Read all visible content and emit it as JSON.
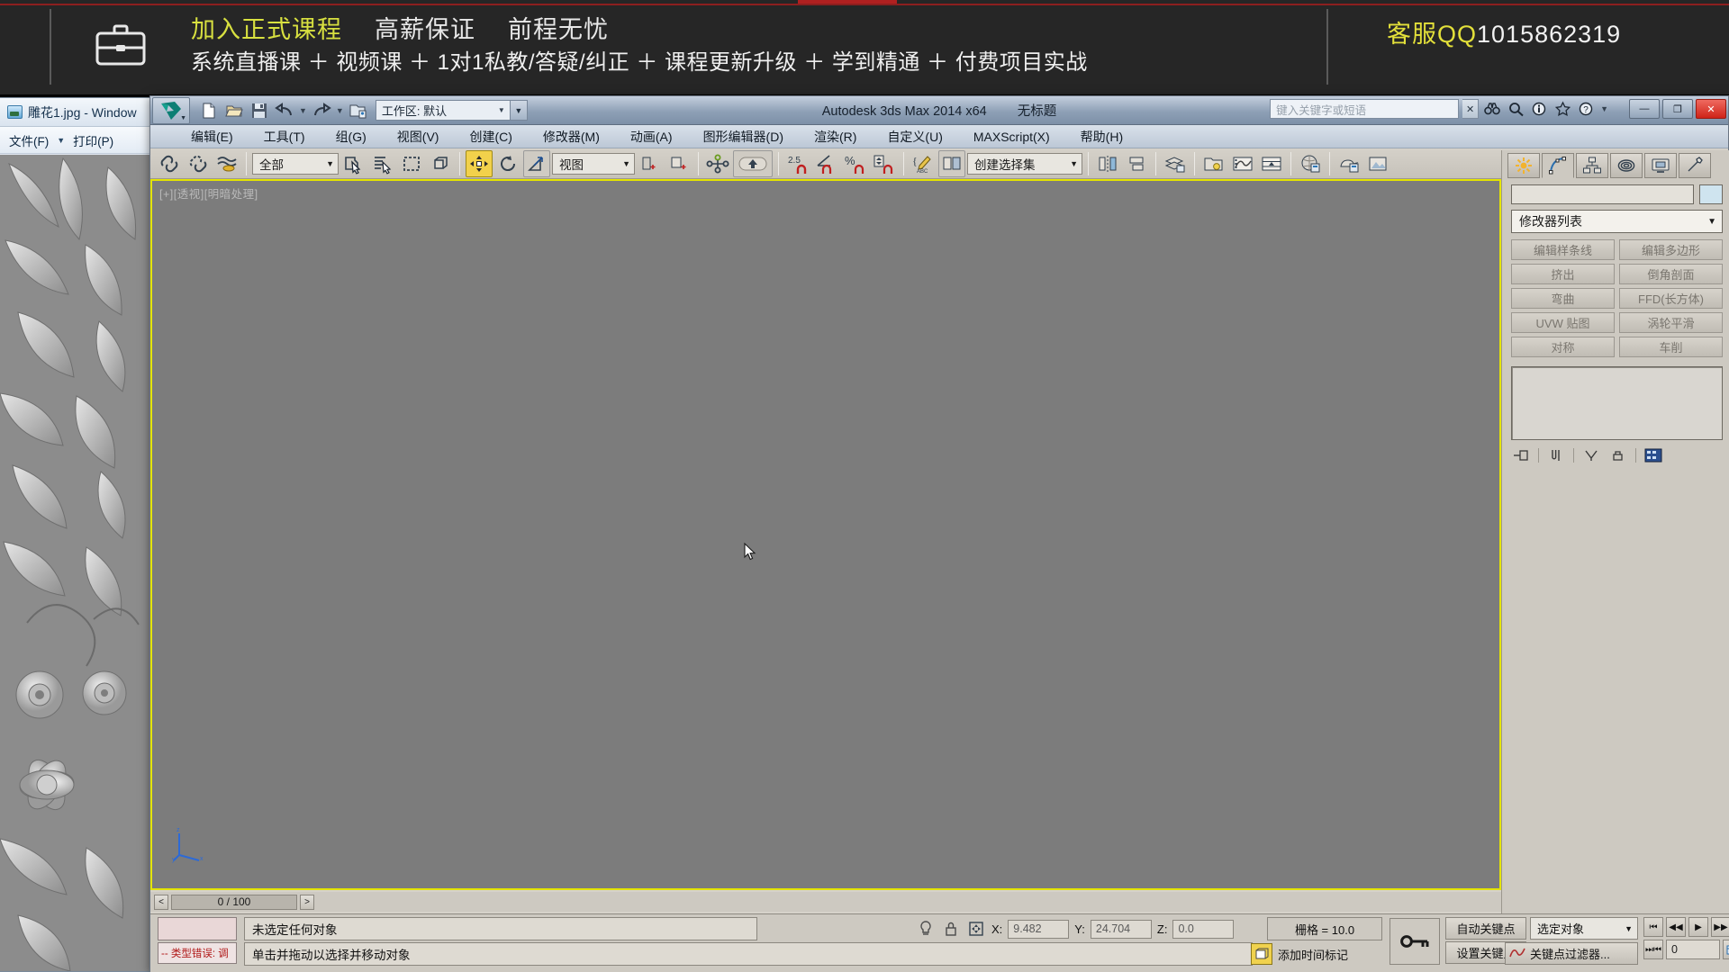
{
  "ad_banner": {
    "line1": {
      "highlight": "加入正式课程",
      "seg2": "高薪保证",
      "seg3": "前程无忧"
    },
    "line2": "系统直播课 ＋ 视频课 ＋ 1对1私教/答疑/纠正 ＋ 课程更新升级 ＋ 学到精通 ＋ 付费项目实战",
    "qq_label": "客服QQ",
    "qq_number": "1015862319",
    "highlight_color": "#d8e040",
    "qq_label_color": "#e3e03a",
    "background": "#262626"
  },
  "image_viewer": {
    "title": "雕花1.jpg - Window",
    "menu": [
      {
        "label": "文件(F)"
      },
      {
        "label": "打印(P)"
      }
    ]
  },
  "max_window": {
    "title": "Autodesk 3ds Max  2014 x64",
    "document": "无标题",
    "workspace_label": "工作区: 默认",
    "search_placeholder": "键入关键字或短语",
    "window_controls": {
      "minimize": "—",
      "maximize": "❐",
      "close": "✕"
    },
    "menu": [
      "编辑(E)",
      "工具(T)",
      "组(G)",
      "视图(V)",
      "创建(C)",
      "修改器(M)",
      "动画(A)",
      "图形编辑器(D)",
      "渲染(R)",
      "自定义(U)",
      "MAXScript(X)",
      "帮助(H)"
    ],
    "toolbar": {
      "selection_filter": "全部",
      "reference_coord": "视图",
      "named_selection_set": "创建选择集",
      "angle_snap_value": "2.5"
    },
    "viewport": {
      "label": "[+][透视][明暗处理]",
      "axis": {
        "x": "x",
        "y": "y",
        "z": "z"
      }
    },
    "timeline": {
      "prev": "<",
      "next": ">",
      "range": "0 / 100"
    },
    "command_panel": {
      "name_field": "",
      "modifier_list": "修改器列表",
      "modifier_buttons": [
        "编辑样条线",
        "编辑多边形",
        "挤出",
        "倒角剖面",
        "弯曲",
        "FFD(长方体)",
        "UVW 贴图",
        "涡轮平滑",
        "对称",
        "车削"
      ]
    },
    "status_bar": {
      "error_text": "--  类型错误: 调",
      "selection_status": "未选定任何对象",
      "prompt": "单击并拖动以选择并移动对象",
      "coords": [
        {
          "label": "X:",
          "value": "9.482"
        },
        {
          "label": "Y:",
          "value": "24.704"
        },
        {
          "label": "Z:",
          "value": "0.0"
        }
      ],
      "grid": "栅格 = 10.0",
      "add_time_tag": "添加时间标记",
      "auto_key": "自动关键点",
      "set_key": "设置关键点",
      "key_target": "选定对象",
      "key_filters": "关键点过滤器...",
      "current_frame": "0"
    }
  }
}
